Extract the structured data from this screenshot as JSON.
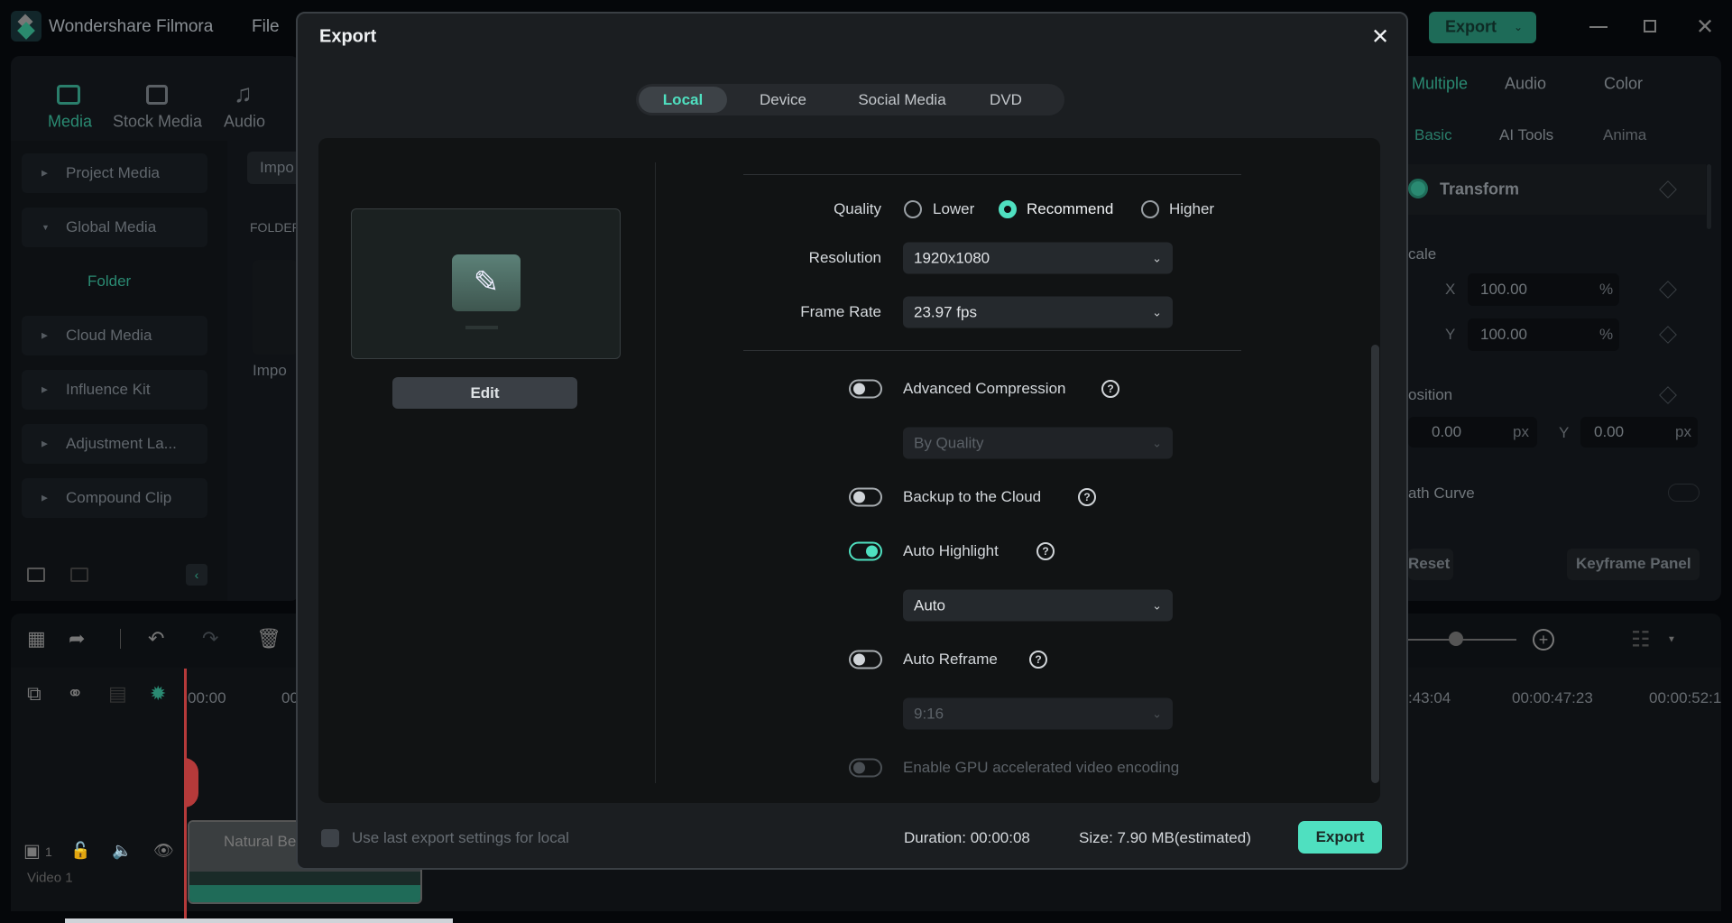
{
  "app": {
    "title": "Wondershare Filmora",
    "menu": [
      "File"
    ],
    "export_label": "Export",
    "accent": "#4fe0c0"
  },
  "left_panel": {
    "tabs": [
      {
        "label": "Media",
        "active": true
      },
      {
        "label": "Stock Media"
      },
      {
        "label": "Audio"
      }
    ],
    "sidebar": [
      {
        "label": "Project Media"
      },
      {
        "label": "Global Media"
      },
      {
        "label": "Folder",
        "active": true
      },
      {
        "label": "Cloud Media"
      },
      {
        "label": "Influence Kit"
      },
      {
        "label": "Adjustment La..."
      },
      {
        "label": "Compound Clip"
      }
    ],
    "import_button": "Impo",
    "folder_header": "FOLDER",
    "import_tile": "Impo"
  },
  "right_panel": {
    "tabs": [
      "Multiple",
      "Audio",
      "Color"
    ],
    "subtabs": [
      "Basic",
      "AI Tools",
      "Anima"
    ],
    "transform": "Transform",
    "scale": "cale",
    "scale_x": {
      "axis": "X",
      "value": "100.00",
      "unit": "%"
    },
    "scale_y": {
      "axis": "Y",
      "value": "100.00",
      "unit": "%"
    },
    "position": "osition",
    "pos_x": {
      "value": "0.00",
      "unit": "px"
    },
    "pos_y": {
      "axis": "Y",
      "value": "0.00",
      "unit": "px"
    },
    "path_curve": "ath Curve",
    "reset": "Reset",
    "keyframe_panel": "Keyframe Panel"
  },
  "timeline": {
    "ruler_left": [
      "00:00",
      "00"
    ],
    "ruler_right": [
      ":43:04",
      "00:00:47:23",
      "00:00:52:1"
    ],
    "track_count": "1",
    "track_name": "Video 1",
    "clip_name": "Natural Be"
  },
  "dialog": {
    "title": "Export",
    "tabs": [
      {
        "label": "Local",
        "active": true
      },
      {
        "label": "Device"
      },
      {
        "label": "Social Media"
      },
      {
        "label": "DVD"
      }
    ],
    "edit_button": "Edit",
    "quality": {
      "label": "Quality",
      "options": [
        "Lower",
        "Recommend",
        "Higher"
      ],
      "selected": "Recommend"
    },
    "resolution": {
      "label": "Resolution",
      "value": "1920x1080"
    },
    "frame_rate": {
      "label": "Frame Rate",
      "value": "23.97 fps"
    },
    "advanced_compression": {
      "label": "Advanced Compression",
      "on": false,
      "dropdown": "By Quality"
    },
    "backup_cloud": {
      "label": "Backup to the Cloud",
      "on": false
    },
    "auto_highlight": {
      "label": "Auto Highlight",
      "on": true,
      "dropdown": "Auto"
    },
    "auto_reframe": {
      "label": "Auto Reframe",
      "on": false,
      "dropdown": "9:16"
    },
    "gpu": {
      "label": "Enable GPU accelerated video encoding",
      "on": false
    },
    "use_last": {
      "label": "Use last export settings for local",
      "checked": false
    },
    "duration": "Duration: 00:00:08",
    "size": "Size: 7.90 MB(estimated)",
    "export_button": "Export"
  }
}
